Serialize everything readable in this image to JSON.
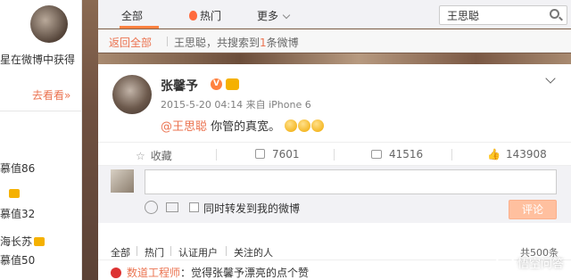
{
  "sidebar": {
    "desc_fragment": "星在微博中获得",
    "more_link": "去看看»",
    "ranks": [
      {
        "value": "慕值86"
      },
      {
        "value": "慕值32"
      },
      {
        "name": "海长苏",
        "value": "慕值50"
      }
    ]
  },
  "tabs": {
    "all": "全部",
    "hot": "热门",
    "more": "更多"
  },
  "search": {
    "value": "王思聪"
  },
  "result_bar": {
    "back": "返回全部",
    "prefix": "王思聪，共搜索到",
    "count": "1",
    "suffix": "条微博"
  },
  "post": {
    "user": "张馨予",
    "v_badge": "V",
    "meta": "2015-5-20 04:14  来自 iPhone 6",
    "mention": "@王思聪",
    "text": " 你管的真宽。",
    "actions": {
      "favorite": "收藏",
      "repost_count": "7601",
      "comment_count": "41516",
      "like_count": "143908"
    }
  },
  "comment_box": {
    "repost_label": "同时转发到我的微博",
    "submit": "评论"
  },
  "filters": {
    "all": "全部",
    "hot": "热门",
    "verified": "认证用户",
    "following": "关注的人",
    "count": "共500条"
  },
  "first_comment": {
    "user": "数道工程师",
    "text": "：觉得张馨予漂亮的点个赞"
  },
  "watermark": {
    "text": "悟空问答"
  },
  "colors": {
    "accent": "#eb7350",
    "tab_underline": "#ff8140",
    "button_disabled": "#ffc09f"
  }
}
